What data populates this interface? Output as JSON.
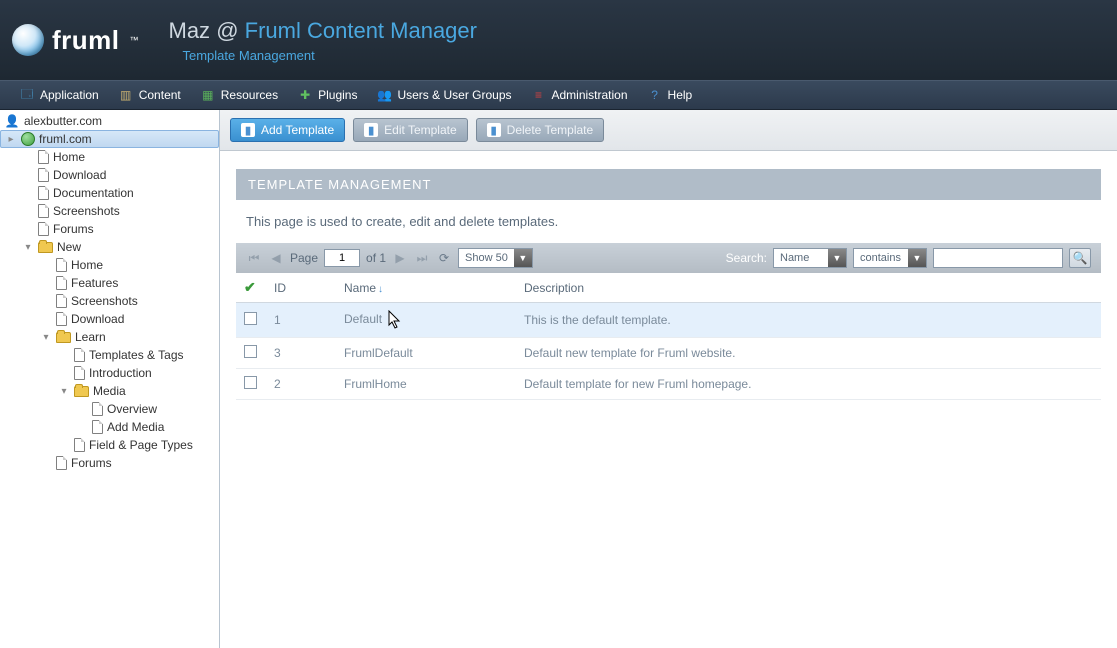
{
  "logo_text": "fruml",
  "header": {
    "user": "Maz",
    "at": "@",
    "app": "Fruml Content Manager",
    "subtitle": "Template Management"
  },
  "menubar": [
    {
      "key": "application",
      "label": "Application",
      "icon": "🗔",
      "color": "#4aa8e0"
    },
    {
      "key": "content",
      "label": "Content",
      "icon": "▥",
      "color": "#c8b070"
    },
    {
      "key": "resources",
      "label": "Resources",
      "icon": "▦",
      "color": "#5ab05a"
    },
    {
      "key": "plugins",
      "label": "Plugins",
      "icon": "✚",
      "color": "#60c060"
    },
    {
      "key": "users",
      "label": "Users & User Groups",
      "icon": "👥",
      "color": "#c08080"
    },
    {
      "key": "administration",
      "label": "Administration",
      "icon": "≡",
      "color": "#d04040"
    },
    {
      "key": "help",
      "label": "Help",
      "icon": "?",
      "color": "#4a90d0"
    }
  ],
  "tree": {
    "sites": [
      {
        "label": "alexbutter.com",
        "type": "user",
        "children": []
      },
      {
        "label": "fruml.com",
        "type": "globe",
        "selected": true,
        "children": [
          {
            "label": "Home",
            "type": "page"
          },
          {
            "label": "Download",
            "type": "page"
          },
          {
            "label": "Documentation",
            "type": "page"
          },
          {
            "label": "Screenshots",
            "type": "page"
          },
          {
            "label": "Forums",
            "type": "page"
          },
          {
            "label": "New",
            "type": "folder",
            "expanded": true,
            "children": [
              {
                "label": "Home",
                "type": "page"
              },
              {
                "label": "Features",
                "type": "page"
              },
              {
                "label": "Screenshots",
                "type": "page"
              },
              {
                "label": "Download",
                "type": "page"
              },
              {
                "label": "Learn",
                "type": "folder",
                "expanded": true,
                "children": [
                  {
                    "label": "Templates & Tags",
                    "type": "page"
                  },
                  {
                    "label": "Introduction",
                    "type": "page"
                  },
                  {
                    "label": "Media",
                    "type": "folder",
                    "expanded": true,
                    "children": [
                      {
                        "label": "Overview",
                        "type": "page"
                      },
                      {
                        "label": "Add Media",
                        "type": "page"
                      }
                    ]
                  },
                  {
                    "label": "Field & Page Types",
                    "type": "page"
                  }
                ]
              },
              {
                "label": "Forums",
                "type": "page"
              }
            ]
          }
        ]
      }
    ]
  },
  "toolbar": {
    "add": "Add Template",
    "edit": "Edit Template",
    "delete": "Delete Template"
  },
  "panel": {
    "title": "TEMPLATE MANAGEMENT",
    "desc": "This page is used to create, edit and delete templates."
  },
  "grid_toolbar": {
    "page_label": "Page",
    "page_value": "1",
    "of_label": "of 1",
    "show_label": "Show 50",
    "search_label": "Search:",
    "search_field": "Name",
    "search_op": "contains",
    "search_value": ""
  },
  "grid": {
    "cols": {
      "id": "ID",
      "name": "Name",
      "desc": "Description"
    },
    "rows": [
      {
        "id": "1",
        "name": "Default",
        "desc": "This is the default template.",
        "selected": true
      },
      {
        "id": "3",
        "name": "FrumlDefault",
        "desc": "Default new template for Fruml website."
      },
      {
        "id": "2",
        "name": "FrumlHome",
        "desc": "Default template for new Fruml homepage."
      }
    ]
  }
}
